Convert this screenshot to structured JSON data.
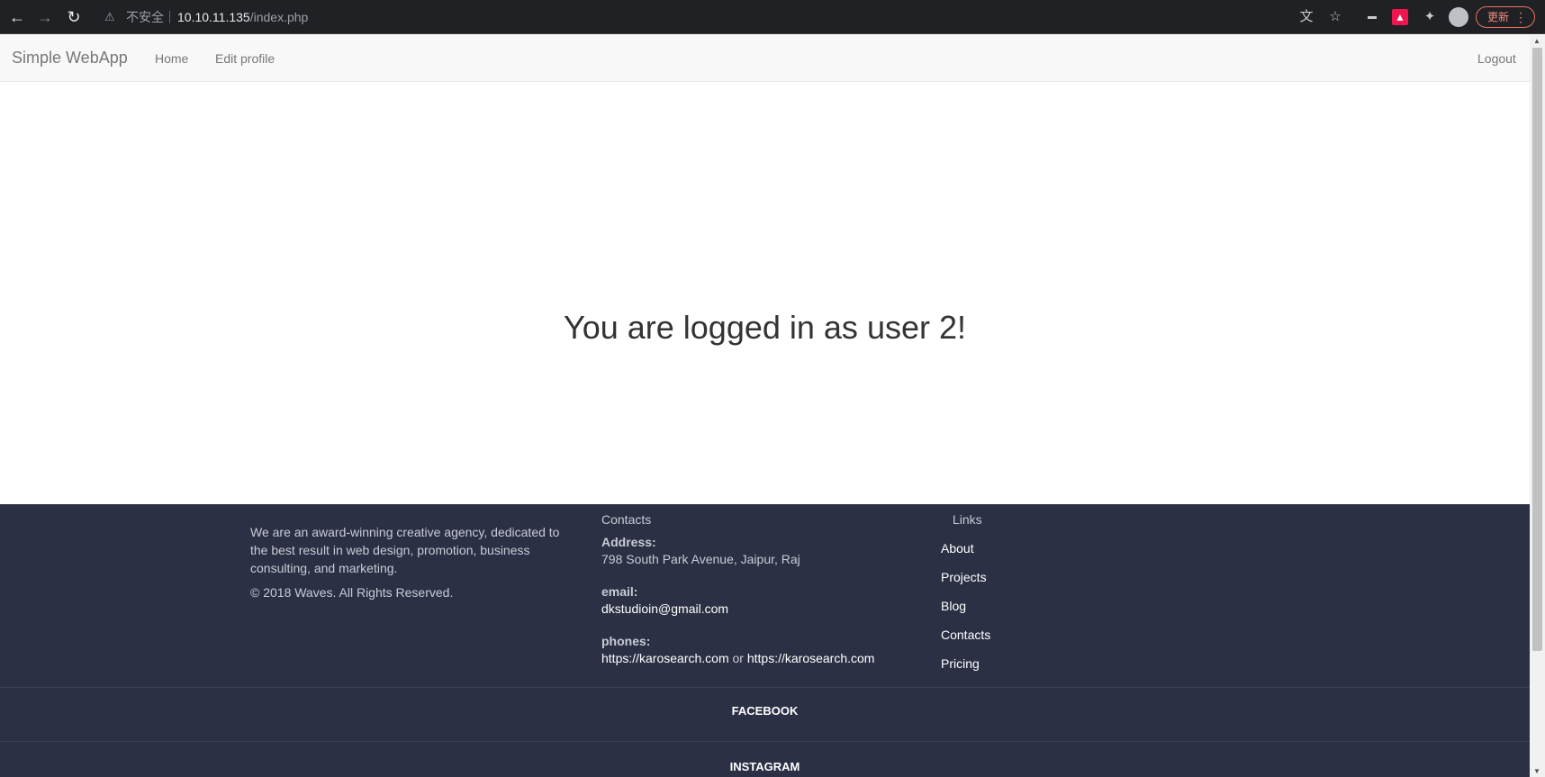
{
  "browser": {
    "back_icon": "arrow-left-icon",
    "forward_icon": "arrow-right-icon",
    "reload_icon": "reload-icon",
    "security_label": "不安全",
    "url_host": "10.10.11.135",
    "url_path": "/index.php",
    "update_label": "更新"
  },
  "navbar": {
    "brand": "Simple WebApp",
    "links": [
      "Home",
      "Edit profile"
    ],
    "logout": "Logout"
  },
  "main": {
    "heading": "You are logged in as user 2!"
  },
  "footer": {
    "about": "We are an award-winning creative agency, dedicated to the best result in web design, promotion, business consulting, and marketing.",
    "copyright": "©  2018 Waves. All Rights Reserved.",
    "contacts_title": "Contacts",
    "address_label": "Address:",
    "address_value": "798 South Park Avenue, Jaipur, Raj",
    "email_label": "email:",
    "email_value": "dkstudioin@gmail.com",
    "phones_label": "phones:",
    "phone_1": "https://karosearch.com",
    "phones_or": "or",
    "phone_2": "https://karosearch.com",
    "links_title": "Links",
    "links": [
      "About",
      "Projects",
      "Blog",
      "Contacts",
      "Pricing"
    ],
    "social_1": "FACEBOOK",
    "social_2": "INSTAGRAM"
  }
}
